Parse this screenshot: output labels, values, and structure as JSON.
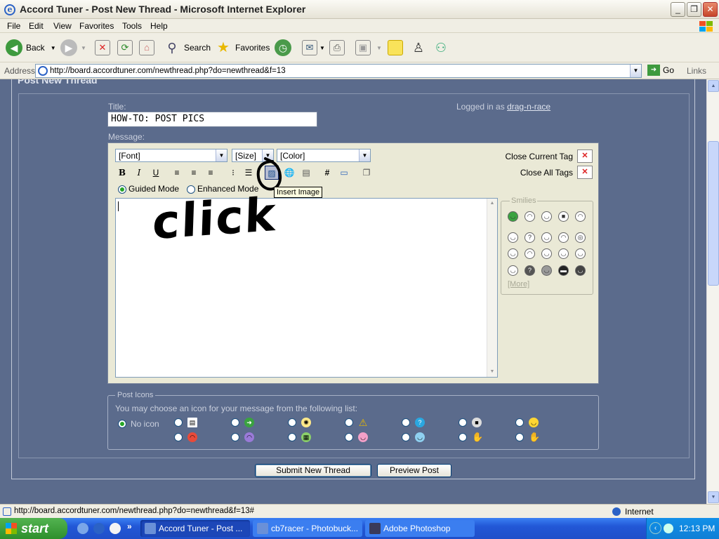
{
  "window": {
    "title": "Accord Tuner - Post New Thread - Microsoft Internet Explorer"
  },
  "menu": [
    "File",
    "Edit",
    "View",
    "Favorites",
    "Tools",
    "Help"
  ],
  "toolbar": {
    "back": "Back",
    "search": "Search",
    "favorites": "Favorites"
  },
  "address": {
    "label": "Address",
    "url": "http://board.accordtuner.com/newthread.php?do=newthread&f=13",
    "go": "Go",
    "links": "Links"
  },
  "form": {
    "header_partial": "Post New Thread",
    "title_label": "Title:",
    "title_value": "HOW-TO: POST PICS",
    "logged_in_prefix": "Logged in as",
    "username": "drag-n-race",
    "message_label": "Message:",
    "font_select": "[Font]",
    "size_select": "[Size]",
    "color_select": "[Color]",
    "close_current_tag": "Close Current Tag",
    "close_all_tags": "Close All Tags",
    "guided_mode": "Guided Mode",
    "enhanced_mode": "Enhanced Mode",
    "tooltip": "Insert Image",
    "annotation": "click",
    "smilies_legend": "Smilies",
    "smilies_more": "[More]",
    "post_icons_legend": "Post Icons",
    "post_icons_desc": "You may choose an icon for your message from the following list:",
    "no_icon": "No icon",
    "submit": "Submit New Thread",
    "preview": "Preview Post"
  },
  "status": {
    "url": "http://board.accordtuner.com/newthread.php?do=newthread&f=13#",
    "zone": "Internet"
  },
  "taskbar": {
    "start": "start",
    "tasks": [
      "Accord Tuner - Post ...",
      "cb7racer - Photobuck...",
      "Adobe Photoshop"
    ],
    "time": "12:13 PM"
  },
  "colors": {
    "page_bg": "#5b6b8c",
    "editor_bg": "#eae9d6",
    "taskbar": "#2257d6",
    "start": "#3a9c37"
  }
}
